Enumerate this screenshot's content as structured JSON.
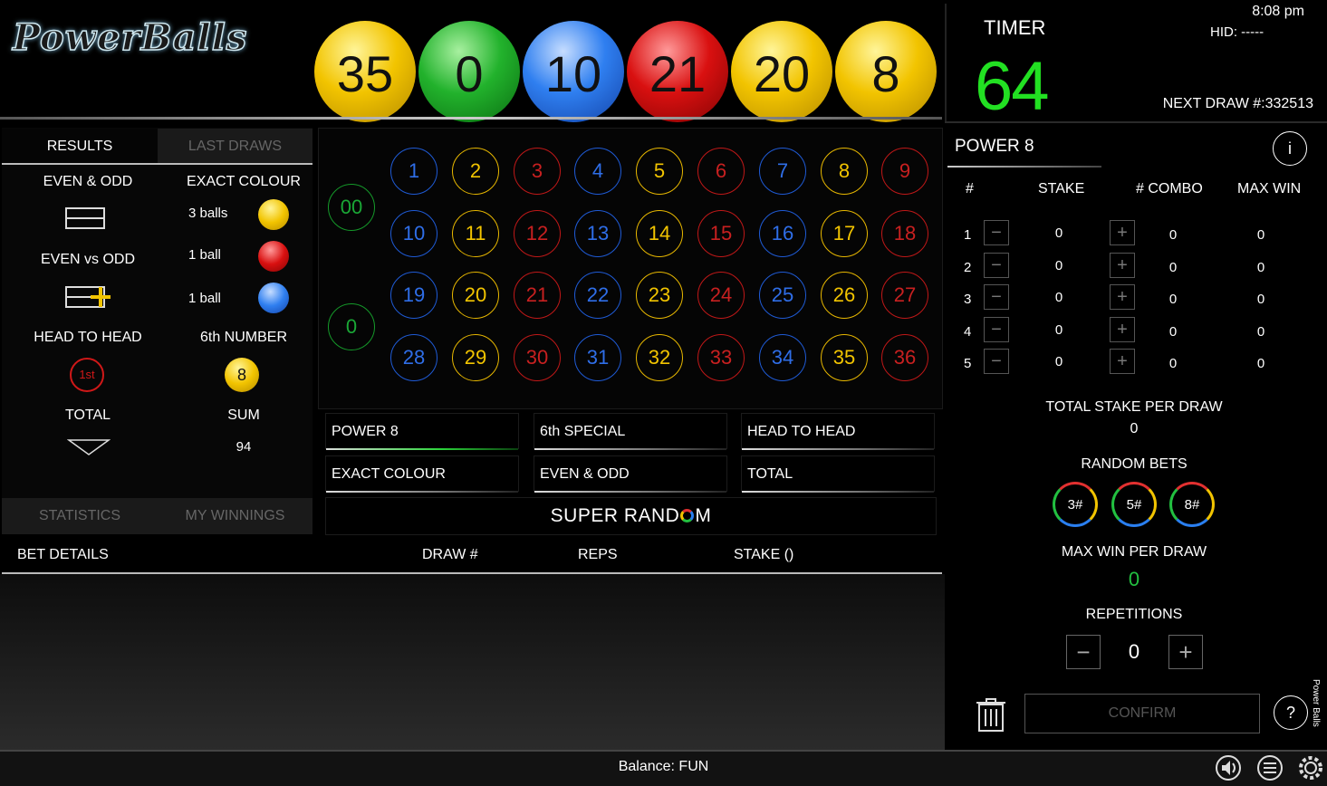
{
  "header": {
    "logo": "PowerBalls",
    "balls": [
      {
        "value": "35",
        "color": "#f2c400"
      },
      {
        "value": "0",
        "color": "#22b22c"
      },
      {
        "value": "10",
        "color": "#2f7ff0"
      },
      {
        "value": "21",
        "color": "#d91010"
      },
      {
        "value": "20",
        "color": "#f2c400"
      },
      {
        "value": "8",
        "color": "#f2c400"
      }
    ]
  },
  "timer": {
    "label": "TIMER",
    "value": "64",
    "clock": "8:08 pm",
    "hid": "HID: -----",
    "next_draw": "NEXT DRAW #:332513"
  },
  "left": {
    "tabs": [
      "RESULTS",
      "LAST DRAWS"
    ],
    "even_odd": "EVEN & ODD",
    "exact_colour": "EXACT COLOUR",
    "even_vs_odd": "EVEN vs ODD",
    "colour_rows": [
      {
        "label": "3 balls",
        "color": "#f2c400"
      },
      {
        "label": "1 ball",
        "color": "#d91010"
      },
      {
        "label": "1 ball",
        "color": "#2f7ff0"
      }
    ],
    "head_to_head": "HEAD TO HEAD",
    "sixth_number": "6th NUMBER",
    "first_label": "1st",
    "sixth_value": "8",
    "total": "TOTAL",
    "sum": "SUM",
    "sum_value": "94",
    "bottom_tabs": [
      "STATISTICS",
      "MY WINNINGS"
    ]
  },
  "board": {
    "zeros": [
      "00",
      "0"
    ],
    "rows": [
      [
        "1",
        "2",
        "3",
        "4",
        "5",
        "6",
        "7",
        "8",
        "9"
      ],
      [
        "10",
        "11",
        "12",
        "13",
        "14",
        "15",
        "16",
        "17",
        "18"
      ],
      [
        "19",
        "20",
        "21",
        "22",
        "23",
        "24",
        "25",
        "26",
        "27"
      ],
      [
        "28",
        "29",
        "30",
        "31",
        "32",
        "33",
        "34",
        "35",
        "36"
      ]
    ],
    "colors": [
      "blue",
      "yellow",
      "red"
    ]
  },
  "bet_types": {
    "power8": "POWER 8",
    "sixth_special": "6th SPECIAL",
    "head_to_head": "HEAD TO HEAD",
    "exact_colour": "EXACT COLOUR",
    "even_odd": "EVEN & ODD",
    "total": "TOTAL",
    "super_random_a": "SUPER RAND",
    "super_random_b": "M"
  },
  "bet_details": {
    "title": "BET DETAILS",
    "draw": "DRAW #",
    "reps": "REPS",
    "stake": "STAKE ()"
  },
  "right": {
    "title": "POWER 8",
    "info": "i",
    "headers": {
      "num": "#",
      "stake": "STAKE",
      "combo": "# COMBO",
      "max_win": "MAX WIN"
    },
    "rows": [
      {
        "n": "1",
        "stake": "0",
        "combo": "0",
        "max": "0"
      },
      {
        "n": "2",
        "stake": "0",
        "combo": "0",
        "max": "0"
      },
      {
        "n": "3",
        "stake": "0",
        "combo": "0",
        "max": "0"
      },
      {
        "n": "4",
        "stake": "0",
        "combo": "0",
        "max": "0"
      },
      {
        "n": "5",
        "stake": "0",
        "combo": "0",
        "max": "0"
      }
    ],
    "minus": "−",
    "plus": "+",
    "total_stake_label": "TOTAL STAKE PER DRAW",
    "total_stake_value": "0",
    "random_bets_label": "RANDOM BETS",
    "random_bets": [
      "3#",
      "5#",
      "8#"
    ],
    "max_win_label": "MAX WIN PER DRAW",
    "max_win_value": "0",
    "repetitions_label": "REPETITIONS",
    "repetitions_value": "0",
    "confirm": "CONFIRM",
    "help": "?",
    "vertical_label": "Power Balls"
  },
  "footer": {
    "balance": "Balance: FUN"
  }
}
